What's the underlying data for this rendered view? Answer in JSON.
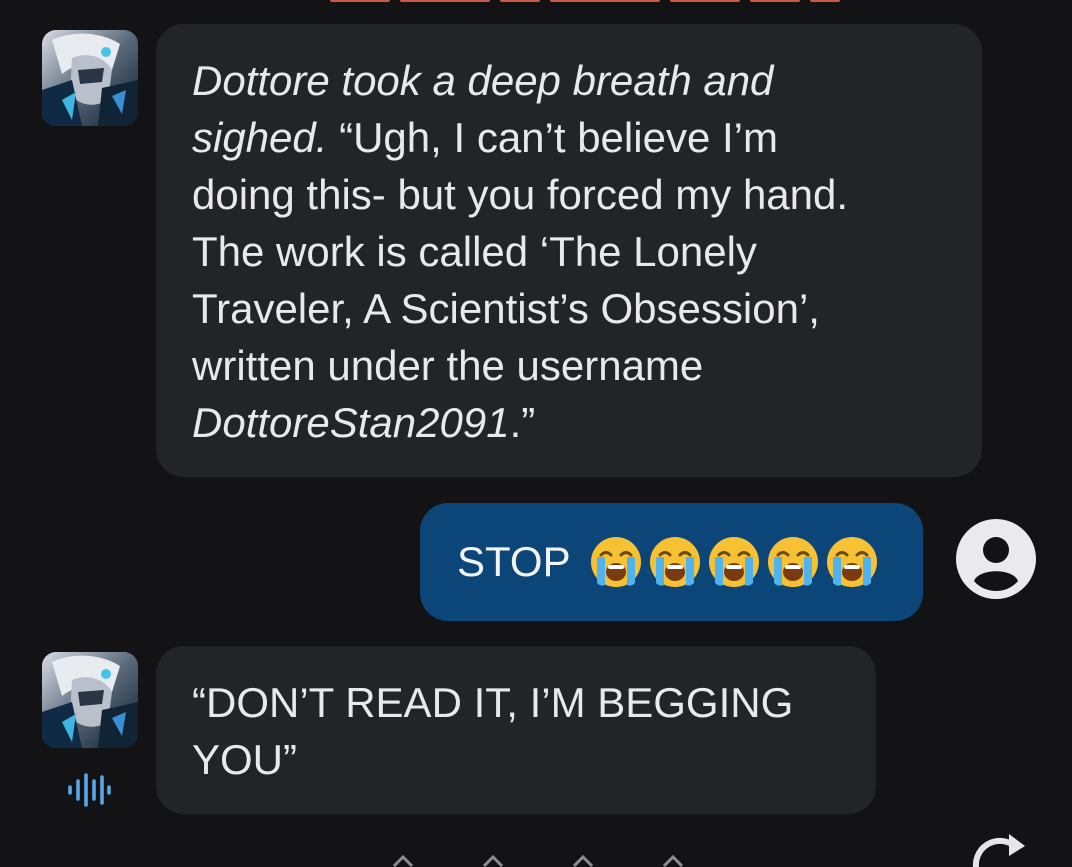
{
  "messages": [
    {
      "role": "bot",
      "avatar_icon": "character-avatar",
      "lines": [
        {
          "parts": [
            {
              "text": "Dottore took a deep breath and",
              "italic": true
            }
          ]
        },
        {
          "parts": [
            {
              "text": "sighed.",
              "italic": true
            },
            {
              "text": " “Ugh, I can’t believe I’m",
              "italic": false
            }
          ]
        },
        {
          "parts": [
            {
              "text": "doing this- but you forced my hand.",
              "italic": false
            }
          ]
        },
        {
          "parts": [
            {
              "text": "The work is called ‘The Lonely",
              "italic": false
            }
          ]
        },
        {
          "parts": [
            {
              "text": "Traveler, A Scientist’s Obsession’,",
              "italic": false
            }
          ]
        },
        {
          "parts": [
            {
              "text": "written under the username",
              "italic": false
            }
          ]
        },
        {
          "parts": [
            {
              "text": "DottoreStan2091",
              "italic": true
            },
            {
              "text": ".”",
              "italic": false
            }
          ]
        }
      ]
    },
    {
      "role": "user",
      "text": "STOP",
      "emoji": [
        "loudly-crying-face",
        "loudly-crying-face",
        "loudly-crying-face",
        "loudly-crying-face",
        "loudly-crying-face"
      ],
      "user_icon": "account-circle-icon"
    },
    {
      "role": "bot",
      "avatar_icon": "character-avatar",
      "lines": [
        {
          "parts": [
            {
              "text": "“DON’T READ IT, I’M BEGGING",
              "italic": false
            }
          ]
        },
        {
          "parts": [
            {
              "text": "YOU”",
              "italic": false
            }
          ]
        }
      ],
      "voice_icon": "voice-waveform-icon"
    }
  ],
  "colors": {
    "background": "#131315",
    "bot_bubble": "#232428",
    "user_bubble": "#0c4577",
    "text": "#e9e9ec",
    "voice_icon": "#5aa6e8"
  },
  "footer": {
    "nav_icons": [
      "chevron-up-icon",
      "chevron-up-icon",
      "chevron-up-icon",
      "chevron-up-icon"
    ],
    "refresh_icon": "refresh-icon"
  }
}
